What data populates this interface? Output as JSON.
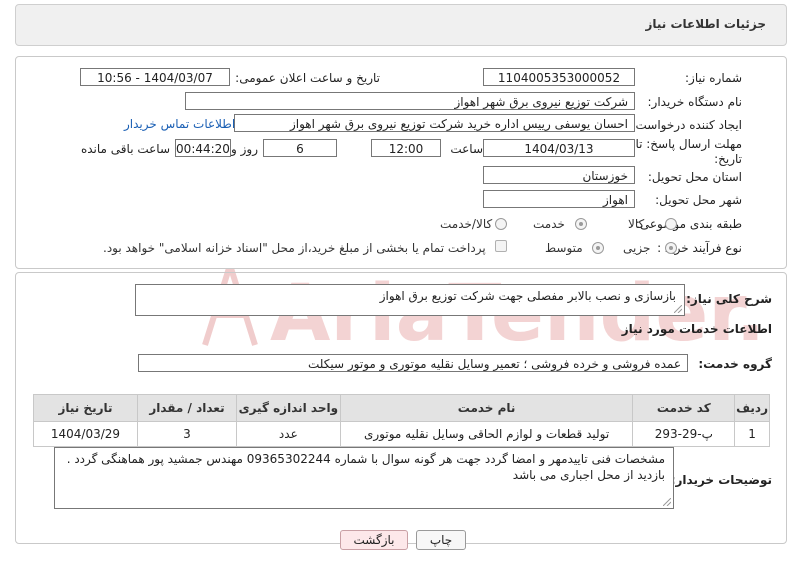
{
  "header": {
    "title": "جزئیات اطلاعات نیاز"
  },
  "form": {
    "need_number_label": "شماره نیاز:",
    "need_number": "1104005353000052",
    "announce_label": "تاریخ و ساعت اعلان عمومی:",
    "announce_value": "1404/03/07 - 10:56",
    "buyer_org_label": "نام دستگاه خریدار:",
    "buyer_org": "شرکت توزیع نیروی برق شهر اهواز",
    "creator_label": "ایجاد کننده درخواست:",
    "creator": "احسان یوسفی رییس اداره خرید شرکت توزیع نیروی برق شهر اهواز",
    "contact_link": "اطلاعات تماس خریدار",
    "deadline_label_1": "مهلت ارسال پاسخ: تا",
    "deadline_label_2": "تاریخ:",
    "deadline_date": "1404/03/13",
    "time_label": "ساعت",
    "deadline_time": "12:00",
    "days_value": "6",
    "days_label": "روز و",
    "remaining_time": "00:44:20",
    "remaining_label": "ساعت باقی مانده",
    "province_label": "استان محل تحویل:",
    "province": "خوزستان",
    "city_label": "شهر محل تحویل:",
    "city": "اهواز",
    "category_label": "طبقه بندی موضوعی:",
    "category_options": [
      "کالا",
      "خدمت",
      "کالا/خدمت"
    ],
    "category_selected": "خدمت",
    "process_label": "نوع فرآیند خرید :",
    "process_options": [
      "جزیی",
      "متوسط"
    ],
    "process_selected": "جزیی",
    "treasury_note": "پرداخت تمام یا بخشی از مبلغ خرید،از محل \"اسناد خزانه اسلامی\" خواهد بود."
  },
  "summary": {
    "label": "شرح کلی نیاز:",
    "text": "بازسازی و نصب بالابر مفصلی جهت شرکت توزیع برق اهواز"
  },
  "services": {
    "section_title": "اطلاعات خدمات مورد نیاز",
    "group_label": "گروه خدمت:",
    "group_value": "عمده فروشی و خرده فروشی ؛ تعمیر وسایل نقلیه موتوری و موتور سیکلت",
    "columns": [
      "ردیف",
      "کد خدمت",
      "نام خدمت",
      "واحد اندازه گیری",
      "تعداد / مقدار",
      "تاریخ نیاز"
    ],
    "rows": [
      {
        "row": "1",
        "code": "پ-29-293",
        "name": "تولید قطعات و لوازم الحاقی وسایل نقلیه موتوری",
        "unit": "عدد",
        "qty": "3",
        "date": "1404/03/29"
      }
    ]
  },
  "buyer_notes": {
    "label": "توضیحات خریدار:",
    "line1": "مشخصات فنی تاییدمهر و امضا گردد جهت هر گونه سوال با شماره 09365302244 مهندس جمشید پور هماهنگی گردد .",
    "line2": "بازدید از محل اجباری می باشد"
  },
  "buttons": {
    "print": "چاپ",
    "back": "بازگشت"
  },
  "watermark": {
    "text": "AriaTender.neT"
  },
  "colors": {
    "link": "#1a5fb4",
    "back_bg": "#fde8ea",
    "header_bg": "#f0f0f0",
    "watermark": "#f1c7c7"
  }
}
